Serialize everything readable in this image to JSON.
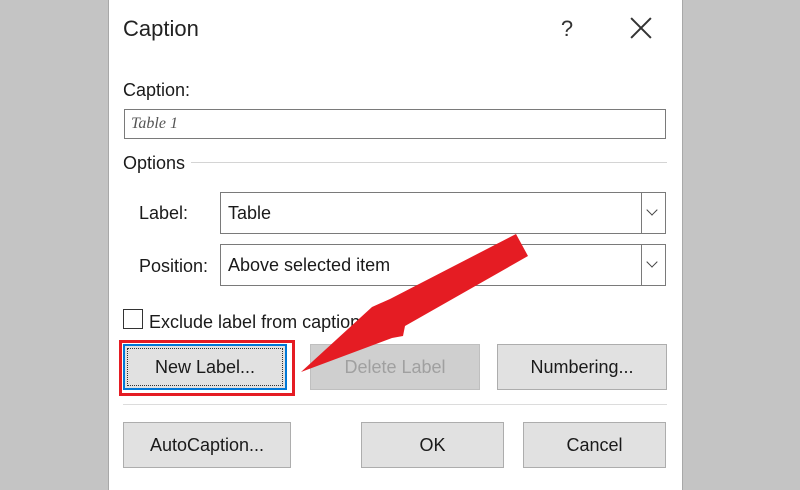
{
  "dialog": {
    "title": "Caption",
    "help": "?",
    "caption_label": "Caption:",
    "caption_value": "Table 1",
    "options_legend": "Options",
    "label_field_label": "Label:",
    "label_value": "Table",
    "position_field_label": "Position:",
    "position_value": "Above selected item",
    "exclude_label": "Exclude label from caption",
    "buttons": {
      "new_label": "New Label...",
      "delete_label": "Delete Label",
      "numbering": "Numbering...",
      "autocaption": "AutoCaption...",
      "ok": "OK",
      "cancel": "Cancel"
    }
  },
  "icons": {
    "close": "close-icon",
    "dropdown": "chevron-down-icon",
    "annotation_arrow": "red-arrow-icon"
  },
  "colors": {
    "annotation_red": "#e51c23",
    "focus_blue": "#0078d7",
    "backdrop": "#c4c4c4"
  }
}
